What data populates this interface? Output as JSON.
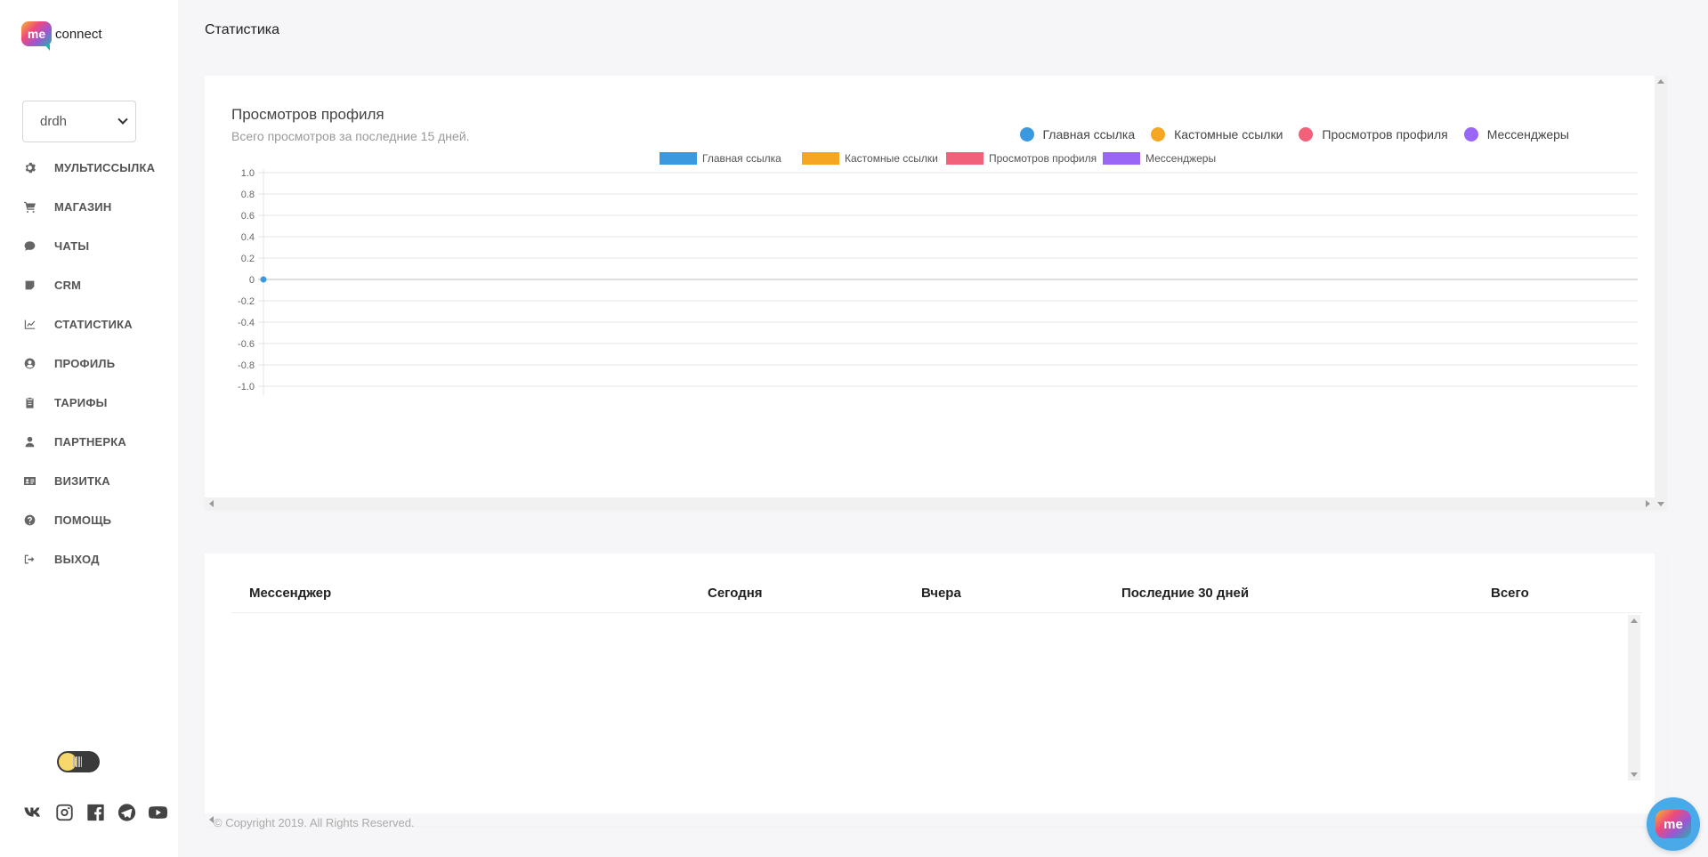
{
  "app": {
    "logo_me": "me",
    "logo_text": "connect"
  },
  "account_select": {
    "value": "drdh"
  },
  "menu": [
    {
      "label": "МУЛЬТИССЫЛКА",
      "icon": "gear-icon"
    },
    {
      "label": "МАГАЗИН",
      "icon": "cart-icon"
    },
    {
      "label": "ЧАТЫ",
      "icon": "chat-icon"
    },
    {
      "label": "CRM",
      "icon": "note-icon"
    },
    {
      "label": "СТАТИСТИКА",
      "icon": "chart-line-icon"
    },
    {
      "label": "ПРОФИЛЬ",
      "icon": "user-circle-icon"
    },
    {
      "label": "ТАРИФЫ",
      "icon": "clipboard-icon"
    },
    {
      "label": "ПАРТНЕРКА",
      "icon": "user-icon"
    },
    {
      "label": "ВИЗИТКА",
      "icon": "id-card-icon"
    },
    {
      "label": "ПОМОЩЬ",
      "icon": "question-circle-icon"
    },
    {
      "label": "ВЫХОД",
      "icon": "sign-out-icon"
    }
  ],
  "socials": [
    "vk-icon",
    "instagram-icon",
    "facebook-icon",
    "telegram-icon",
    "youtube-icon"
  ],
  "page_title": "Статистика",
  "chart_card": {
    "title": "Просмотров профиля",
    "subtitle": "Всего просмотров за последние 15 дней.",
    "top_legend": [
      {
        "label": "Главная ссылка",
        "color": "#3b99e0"
      },
      {
        "label": "Кастомные ссылки",
        "color": "#f5a623"
      },
      {
        "label": "Просмотров профиля",
        "color": "#f2617a"
      },
      {
        "label": "Мессенджеры",
        "color": "#9a66f5"
      }
    ]
  },
  "chart_data": {
    "type": "line",
    "ylim": [
      -1.0,
      1.0
    ],
    "yticks": [
      "1.0",
      "0.8",
      "0.6",
      "0.4",
      "0.2",
      "0",
      "-0.2",
      "-0.4",
      "-0.6",
      "-0.8",
      "-1.0"
    ],
    "series": [
      {
        "name": "Главная ссылка",
        "color": "#3b99e0",
        "values": [
          0
        ]
      },
      {
        "name": "Кастомные ссылки",
        "color": "#f5a623",
        "values": []
      },
      {
        "name": "Просмотров профиля",
        "color": "#f2617a",
        "values": []
      },
      {
        "name": "Мессенджеры",
        "color": "#9a66f5",
        "values": []
      }
    ],
    "grid": true,
    "legend": "top-center"
  },
  "table": {
    "columns": [
      "Мессенджер",
      "Сегодня",
      "Вчера",
      "Последние 30 дней",
      "Всего"
    ],
    "rows": []
  },
  "footer": "© Copyright 2019. All Rights Reserved.",
  "fab_label": "me"
}
